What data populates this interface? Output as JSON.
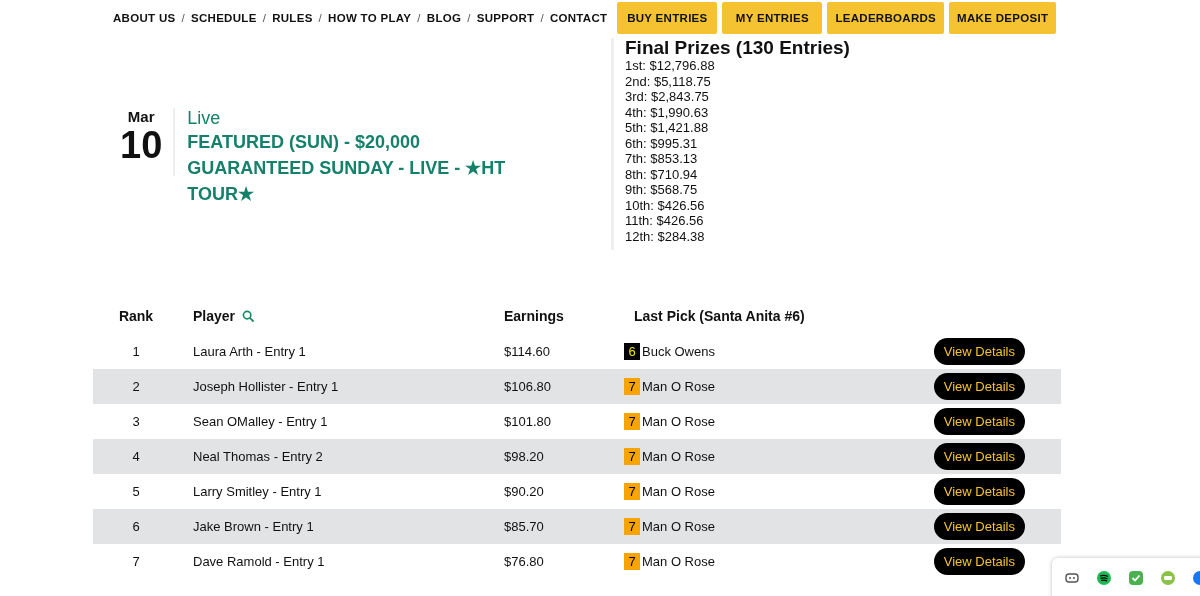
{
  "nav": {
    "links": [
      "ABOUT US",
      "SCHEDULE",
      "RULES",
      "HOW TO PLAY",
      "BLOG",
      "SUPPORT",
      "CONTACT"
    ],
    "separator": "/",
    "buttons": [
      "BUY ENTRIES",
      "MY ENTRIES",
      "LEADERBOARDS",
      "MAKE DEPOSIT"
    ]
  },
  "event": {
    "month": "Mar",
    "day": "10",
    "status": "Live",
    "title": "FEATURED (SUN) - $20,000 GUARANTEED SUNDAY - LIVE - ★HT TOUR★"
  },
  "prizes": {
    "title": "Final Prizes (130 Entries)",
    "items": [
      "1st: $12,796.88",
      "2nd: $5,118.75",
      "3rd: $2,843.75",
      "4th: $1,990.63",
      "5th: $1,421.88",
      "6th: $995.31",
      "7th: $853.13",
      "8th: $710.94",
      "9th: $568.75",
      "10th: $426.56",
      "11th: $426.56",
      "12th: $284.38"
    ]
  },
  "table": {
    "columns": [
      "Rank",
      "Player",
      "Earnings",
      "Last Pick (Santa Anita #6)"
    ],
    "rows": [
      {
        "rank": "1",
        "player": "Laura Arth - Entry 1",
        "earnings": "$114.60",
        "pick_number": "6",
        "color": "#000000",
        "pick_name": "Buck Owens",
        "action": "View Details"
      },
      {
        "rank": "2",
        "player": "Joseph Hollister - Entry 1",
        "earnings": "$106.80",
        "pick_number": "7",
        "color": "#f7a400",
        "pick_name": "Man O Rose",
        "action": "View Details"
      },
      {
        "rank": "3",
        "player": "Sean OMalley - Entry 1",
        "earnings": "$101.80",
        "pick_number": "7",
        "color": "#f7a400",
        "pick_name": "Man O Rose",
        "action": "View Details"
      },
      {
        "rank": "4",
        "player": "Neal Thomas - Entry 2",
        "earnings": "$98.20",
        "pick_number": "7",
        "color": "#f7a400",
        "pick_name": "Man O Rose",
        "action": "View Details"
      },
      {
        "rank": "5",
        "player": "Larry Smitley - Entry 1",
        "earnings": "$90.20",
        "pick_number": "7",
        "color": "#f7a400",
        "pick_name": "Man O Rose",
        "action": "View Details"
      },
      {
        "rank": "6",
        "player": "Jake Brown - Entry 1",
        "earnings": "$85.70",
        "pick_number": "7",
        "color": "#f7a400",
        "pick_name": "Man O Rose",
        "action": "View Details"
      },
      {
        "rank": "7",
        "player": "Dave Ramold - Entry 1",
        "earnings": "$76.80",
        "pick_number": "7",
        "color": "#f7a400",
        "pick_name": "Man O Rose",
        "action": "View Details"
      }
    ]
  }
}
